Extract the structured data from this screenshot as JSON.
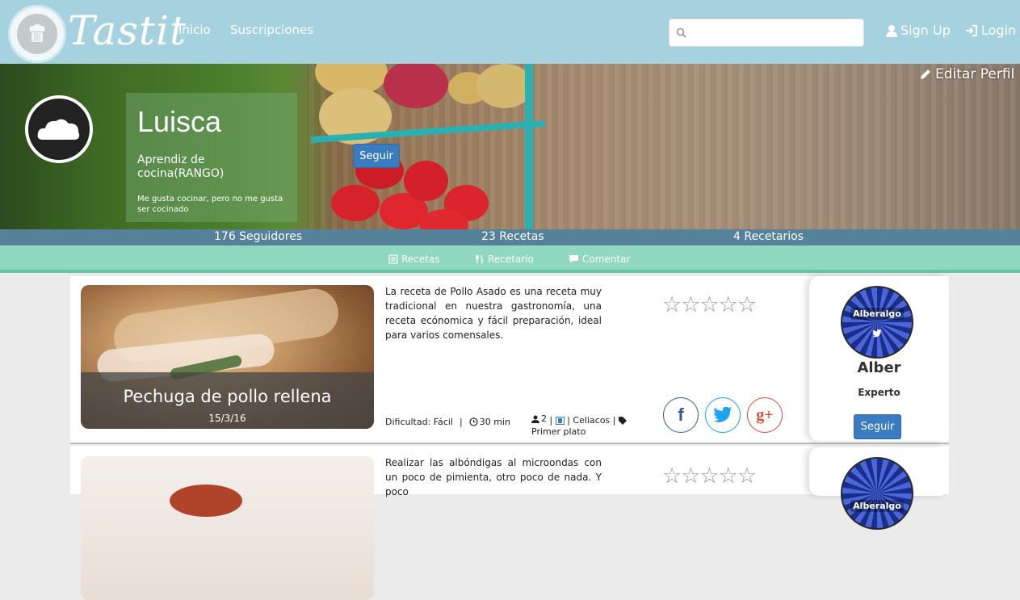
{
  "header": {
    "brand": "Tastit",
    "nav": [
      "Inicio",
      "Suscripciones"
    ],
    "search_placeholder": "",
    "sign_up": "Sign Up",
    "login": "Login"
  },
  "profile": {
    "name": "Luisca",
    "rank": "Aprendiz de cocina(RANGO)",
    "bio": "Me gusta cocinar, pero no me gusta ser cocinado",
    "follow_label": "Seguir",
    "edit_label": "Editar Perfil"
  },
  "stats": {
    "followers": "176 Seguidores",
    "recipes": "23 Recetas",
    "recipe_books": "4 Recetarios"
  },
  "tabs": [
    "Recetas",
    "Recetario",
    "Comentar"
  ],
  "recipes": [
    {
      "title": "Pechuga de pollo rellena",
      "date": "15/3/16",
      "description": "La receta de Pollo Asado es una receta muy tradicional en nuestra gastronomía, una receta ecónomica y fácil preparación, ideal para varios comensales.",
      "difficulty": "Dificultad: Fácil",
      "time": "30 min",
      "servings": "2",
      "tag": "Celiacos",
      "category": "Primer plato",
      "stars": "☆☆☆☆☆",
      "author": {
        "badge": "Alberalgo",
        "name": "Alber",
        "rank": "Experto",
        "follow": "Seguir"
      }
    },
    {
      "description": "Realizar las albóndigas al microondas con un poco de pimienta, otro poco de nada. Y poco",
      "stars": "☆☆☆☆☆",
      "author": {
        "badge": "Alberalgo"
      }
    }
  ],
  "colors": {
    "header_bg": "#a6d2e0",
    "tab_bg": "#90d8bf",
    "button_blue": "#3a7cbf",
    "facebook": "#3b5998",
    "twitter": "#1da1f2",
    "google": "#dd4b39"
  }
}
